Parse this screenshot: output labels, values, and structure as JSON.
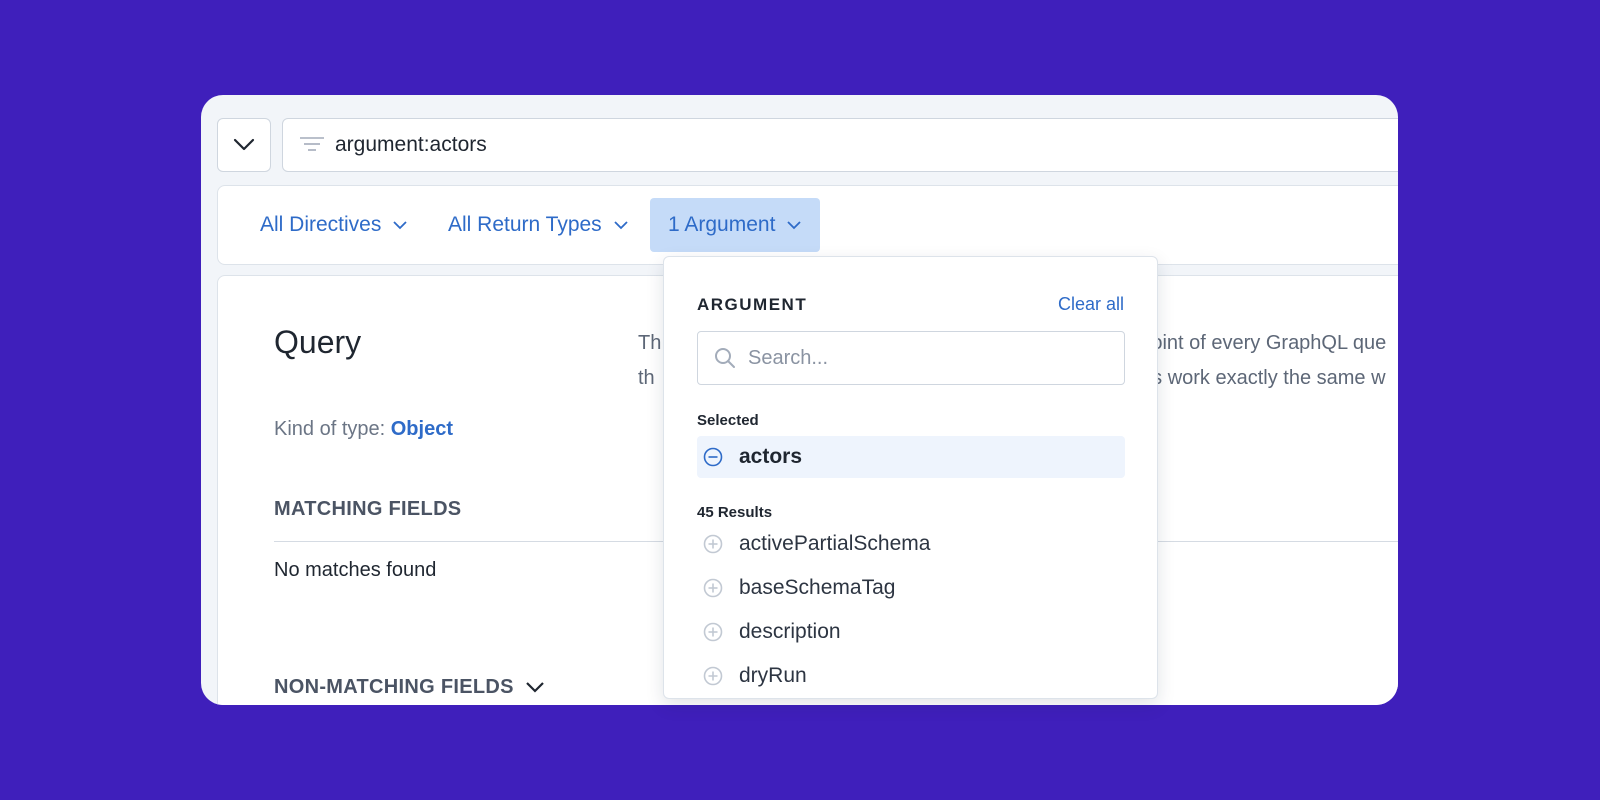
{
  "search": {
    "query": "argument:actors"
  },
  "filters": {
    "directives": "All Directives",
    "return_types": "All Return Types",
    "argument": "1 Argument"
  },
  "type_detail": {
    "title": "Query",
    "description_line1": "Th",
    "description_line1_end": "oint of every GraphQL que",
    "description_line2": "th",
    "description_line2_end": "ls work exactly the same w",
    "kind_label": "Kind of type:",
    "kind_value": "Object",
    "matching_header": "MATCHING FIELDS",
    "no_matches": "No matches found",
    "non_matching_header": "NON-MATCHING FIELDS"
  },
  "argument_dropdown": {
    "heading": "ARGUMENT",
    "clear_all": "Clear all",
    "search_placeholder": "Search...",
    "selected_label": "Selected",
    "selected_item": "actors",
    "results_label": "45 Results",
    "results": [
      "activePartialSchema",
      "baseSchemaTag",
      "description",
      "dryRun"
    ]
  },
  "colors": {
    "background": "#3f1fbb",
    "accent": "#2e6bc8",
    "active_filter": "#c5dbf8"
  }
}
